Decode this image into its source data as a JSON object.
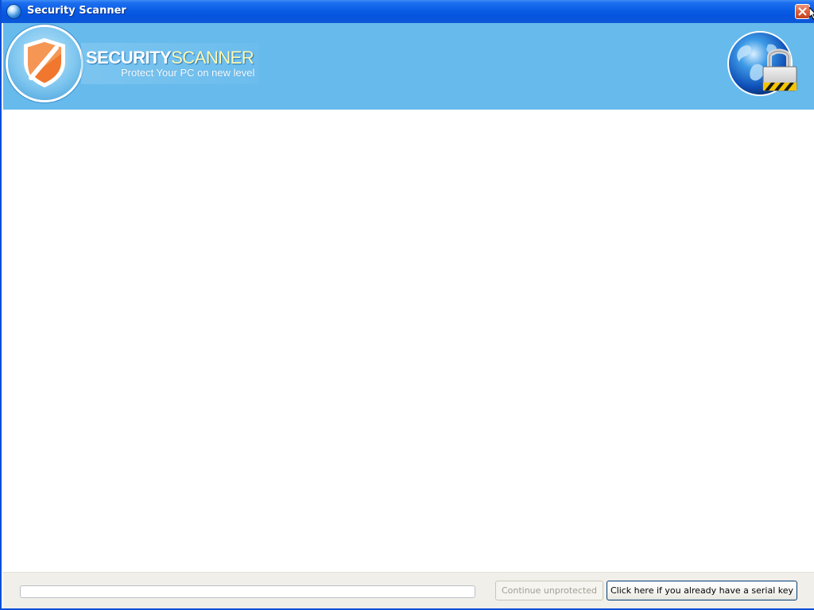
{
  "window": {
    "title": "Security Scanner",
    "icon": "globe-app-icon"
  },
  "banner": {
    "brand_word1": "SECURITY",
    "brand_word2": "SCANNER",
    "tagline": "Protect Your PC on new level",
    "logo_icon": "shield-icon",
    "right_icon": "globe-padlock-icon"
  },
  "footer": {
    "progress_fraction": 0,
    "continue_label": "Continue unprotected",
    "continue_enabled": false,
    "serial_label": "Click here if you already have a serial key"
  },
  "colors": {
    "titlebar_blue": "#0654df",
    "banner_blue": "#66baec",
    "shield_orange": "#f0772d",
    "footer_bg": "#f1efe9"
  }
}
